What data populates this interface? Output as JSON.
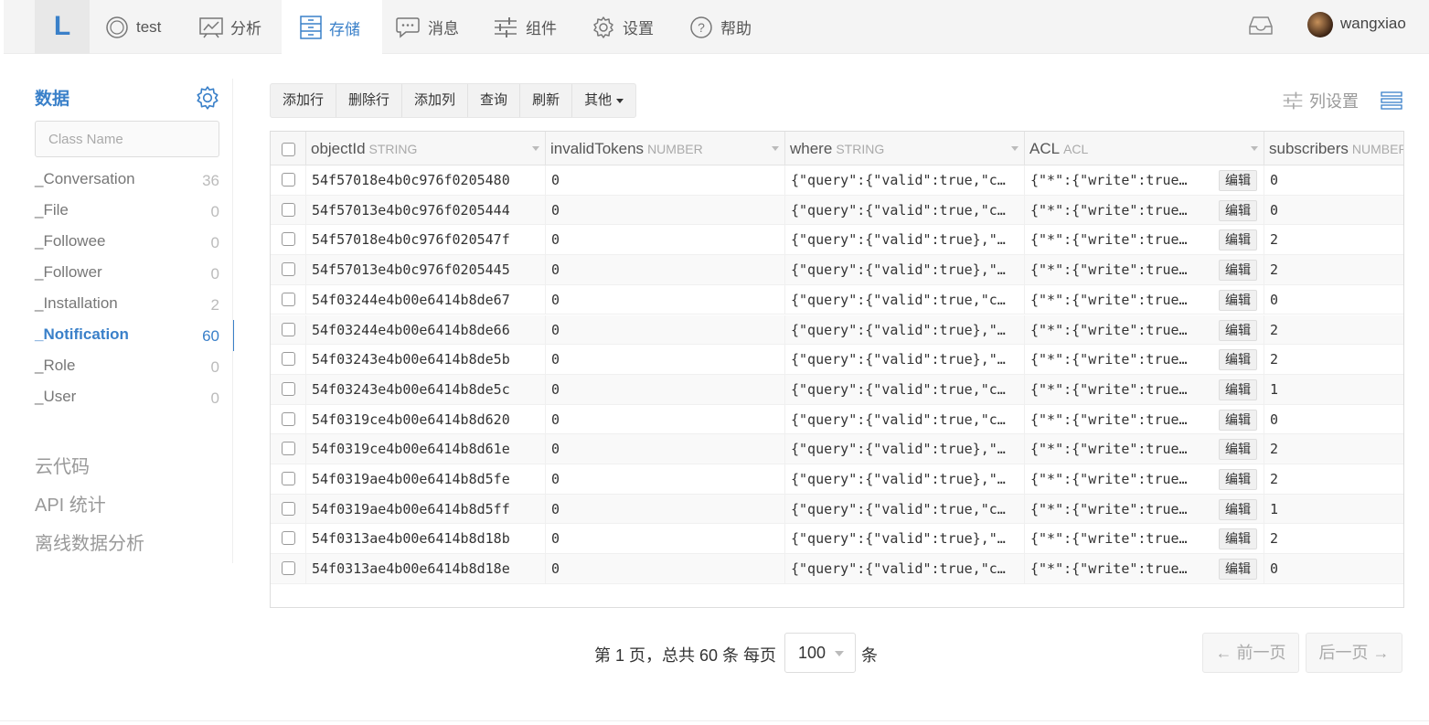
{
  "nav": {
    "logo": "L",
    "items": [
      {
        "label": "test",
        "icon": "circle-icon"
      },
      {
        "label": "分析",
        "icon": "chart-icon"
      },
      {
        "label": "存储",
        "icon": "storage-icon",
        "active": true
      },
      {
        "label": "消息",
        "icon": "chat-icon"
      },
      {
        "label": "组件",
        "icon": "sliders-icon"
      },
      {
        "label": "设置",
        "icon": "gear-icon"
      },
      {
        "label": "帮助",
        "icon": "help-icon"
      }
    ],
    "username": "wangxiao",
    "accent": "#3a80c9"
  },
  "sidebar": {
    "title": "数据",
    "search_placeholder": "Class Name",
    "classes": [
      {
        "name": "_Conversation",
        "count": "36"
      },
      {
        "name": "_File",
        "count": "0"
      },
      {
        "name": "_Followee",
        "count": "0"
      },
      {
        "name": "_Follower",
        "count": "0"
      },
      {
        "name": "_Installation",
        "count": "2"
      },
      {
        "name": "_Notification",
        "count": "60",
        "active": true
      },
      {
        "name": "_Role",
        "count": "0"
      },
      {
        "name": "_User",
        "count": "0"
      }
    ],
    "links": [
      "云代码",
      "API 统计",
      "离线数据分析"
    ]
  },
  "toolbar": {
    "buttons": [
      "添加行",
      "删除行",
      "添加列",
      "查询",
      "刷新",
      "其他"
    ],
    "column_settings": "列设置"
  },
  "table": {
    "columns": [
      {
        "name": "objectId",
        "type": "STRING"
      },
      {
        "name": "invalidTokens",
        "type": "NUMBER"
      },
      {
        "name": "where",
        "type": "STRING"
      },
      {
        "name": "ACL",
        "type": "ACL"
      },
      {
        "name": "subscribers",
        "type": "NUMBER"
      }
    ],
    "edit_label": "编辑",
    "rows": [
      {
        "objectId": "54f57018e4b0c976f0205480",
        "invalidTokens": "0",
        "where": "{\"query\":{\"valid\":true,\"c…",
        "acl": "{\"*\":{\"write\":true…",
        "subscribers": "0"
      },
      {
        "objectId": "54f57013e4b0c976f0205444",
        "invalidTokens": "0",
        "where": "{\"query\":{\"valid\":true,\"c…",
        "acl": "{\"*\":{\"write\":true…",
        "subscribers": "0"
      },
      {
        "objectId": "54f57018e4b0c976f020547f",
        "invalidTokens": "0",
        "where": "{\"query\":{\"valid\":true},\"…",
        "acl": "{\"*\":{\"write\":true…",
        "subscribers": "2"
      },
      {
        "objectId": "54f57013e4b0c976f0205445",
        "invalidTokens": "0",
        "where": "{\"query\":{\"valid\":true},\"…",
        "acl": "{\"*\":{\"write\":true…",
        "subscribers": "2"
      },
      {
        "objectId": "54f03244e4b00e6414b8de67",
        "invalidTokens": "0",
        "where": "{\"query\":{\"valid\":true,\"c…",
        "acl": "{\"*\":{\"write\":true…",
        "subscribers": "0"
      },
      {
        "objectId": "54f03244e4b00e6414b8de66",
        "invalidTokens": "0",
        "where": "{\"query\":{\"valid\":true},\"…",
        "acl": "{\"*\":{\"write\":true…",
        "subscribers": "2"
      },
      {
        "objectId": "54f03243e4b00e6414b8de5b",
        "invalidTokens": "0",
        "where": "{\"query\":{\"valid\":true},\"…",
        "acl": "{\"*\":{\"write\":true…",
        "subscribers": "2"
      },
      {
        "objectId": "54f03243e4b00e6414b8de5c",
        "invalidTokens": "0",
        "where": "{\"query\":{\"valid\":true,\"c…",
        "acl": "{\"*\":{\"write\":true…",
        "subscribers": "1"
      },
      {
        "objectId": "54f0319ce4b00e6414b8d620",
        "invalidTokens": "0",
        "where": "{\"query\":{\"valid\":true,\"c…",
        "acl": "{\"*\":{\"write\":true…",
        "subscribers": "0"
      },
      {
        "objectId": "54f0319ce4b00e6414b8d61e",
        "invalidTokens": "0",
        "where": "{\"query\":{\"valid\":true},\"…",
        "acl": "{\"*\":{\"write\":true…",
        "subscribers": "2"
      },
      {
        "objectId": "54f0319ae4b00e6414b8d5fe",
        "invalidTokens": "0",
        "where": "{\"query\":{\"valid\":true},\"…",
        "acl": "{\"*\":{\"write\":true…",
        "subscribers": "2"
      },
      {
        "objectId": "54f0319ae4b00e6414b8d5ff",
        "invalidTokens": "0",
        "where": "{\"query\":{\"valid\":true,\"c…",
        "acl": "{\"*\":{\"write\":true…",
        "subscribers": "1"
      },
      {
        "objectId": "54f0313ae4b00e6414b8d18b",
        "invalidTokens": "0",
        "where": "{\"query\":{\"valid\":true},\"…",
        "acl": "{\"*\":{\"write\":true…",
        "subscribers": "2"
      },
      {
        "objectId": "54f0313ae4b00e6414b8d18e",
        "invalidTokens": "0",
        "where": "{\"query\":{\"valid\":true,\"c…",
        "acl": "{\"*\":{\"write\":true…",
        "subscribers": "0"
      }
    ]
  },
  "pagination": {
    "info": "第 1 页，总共 60 条 每页",
    "page_size": "100",
    "unit": "条",
    "prev": "← 前一页",
    "next": "后一页 →"
  }
}
